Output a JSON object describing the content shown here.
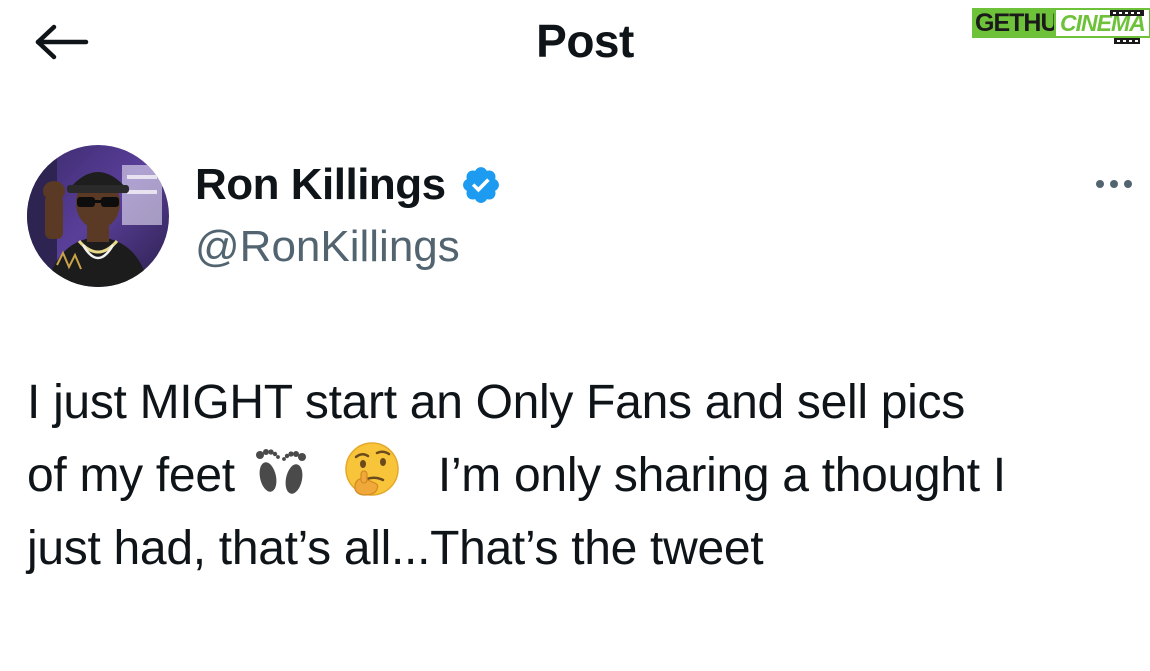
{
  "header": {
    "title": "Post",
    "back_icon": "arrow-left-icon"
  },
  "watermark": {
    "part1": "GETHU",
    "part2": "CINEMA",
    "accent_color": "#6ec23a"
  },
  "author": {
    "display_name": "Ron Killings",
    "handle": "@RonKillings",
    "verified": true,
    "verified_color": "#1d9bf0",
    "avatar_icon": "avatar"
  },
  "more_icon": "more-horizontal-icon",
  "tweet": {
    "line1": "I just MIGHT start an Only Fans  and sell pics",
    "line2_before": "of my feet",
    "emoji1": "footprints-icon",
    "emoji2": "thinking-face-icon",
    "line2_after": "I’m only sharing a thought I",
    "line3": "just had, that’s all...That’s the tweet"
  },
  "colors": {
    "text": "#0f1419",
    "secondary_text": "#536471"
  }
}
